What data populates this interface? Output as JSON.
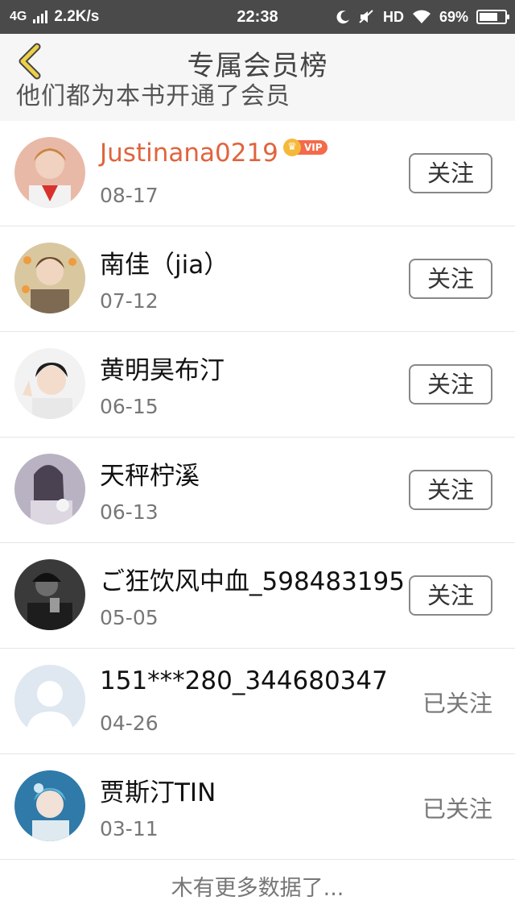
{
  "status_bar": {
    "network": "4G",
    "speed": "2.2K/s",
    "time": "22:38",
    "hd": "HD",
    "battery": "69%",
    "icons": [
      "signal-bars-icon",
      "moon-icon",
      "mute-icon",
      "wifi-icon",
      "battery-icon"
    ]
  },
  "header": {
    "title": "专属会员榜",
    "subtitle": "他们都为本书开通了会员",
    "back_icon": "chevron-left-icon",
    "accent": "#e8c020"
  },
  "members": [
    {
      "name": "Justinana0219",
      "date": "08-17",
      "vip": true,
      "vip_label": "VIP",
      "action": "关注"
    },
    {
      "name": "南佳（jia）",
      "date": "07-12",
      "vip": false,
      "action": "关注"
    },
    {
      "name": "黄明昊布汀",
      "date": "06-15",
      "vip": false,
      "action": "关注"
    },
    {
      "name": "天秤柠溪",
      "date": "06-13",
      "vip": false,
      "action": "关注"
    },
    {
      "name": "ご狂饮风中血_598483195",
      "date": "05-05",
      "vip": false,
      "action": "关注"
    },
    {
      "name": "151***280_344680347",
      "date": "04-26",
      "vip": false,
      "action": "已关注"
    },
    {
      "name": "贾斯汀TIN",
      "date": "03-11",
      "vip": false,
      "action": "已关注"
    }
  ],
  "footer": "木有更多数据了...",
  "colors": {
    "vip_name": "#e0643e",
    "status_bar": "#4a4a4a"
  }
}
